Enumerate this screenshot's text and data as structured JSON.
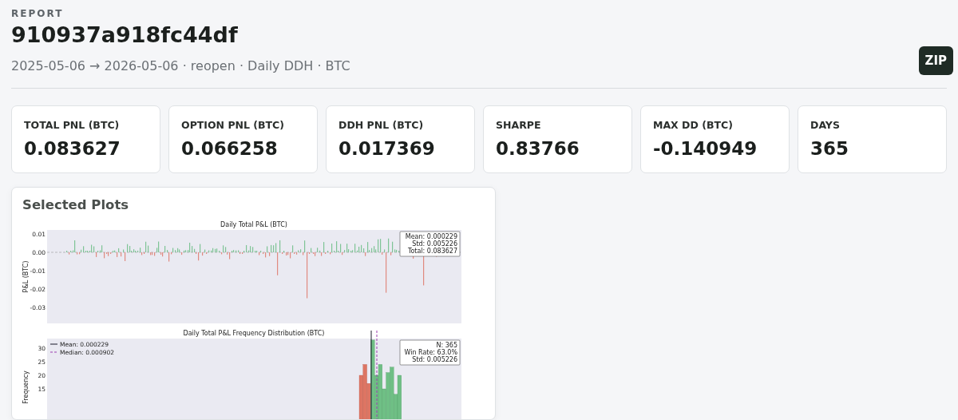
{
  "header": {
    "eyebrow": "REPORT",
    "title": "910937a918fc44df",
    "subtitle": "2025-05-06 → 2026-05-06 · reopen · Daily DDH · BTC",
    "download_button": "ZIP"
  },
  "stats": [
    {
      "label": "TOTAL PNL (BTC)",
      "value": "0.083627"
    },
    {
      "label": "OPTION PNL (BTC)",
      "value": "0.066258"
    },
    {
      "label": "DDH PNL (BTC)",
      "value": "0.017369"
    },
    {
      "label": "SHARPE",
      "value": "0.83766"
    },
    {
      "label": "MAX DD (BTC)",
      "value": "-0.140949"
    },
    {
      "label": "DAYS",
      "value": "365"
    }
  ],
  "plots_panel": {
    "title": "Selected Plots",
    "plots": [
      {
        "kind": "daily_bars",
        "title": "Daily Total P&L (BTC)",
        "ylabel": "P&L (BTC)",
        "yticks": [
          "0.01",
          "0.00",
          "-0.01",
          "-0.02",
          "-0.03"
        ],
        "stats": [
          "Mean: 0.000229",
          "Std: 0.005226",
          "Total: 0.083627"
        ]
      },
      {
        "kind": "histogram",
        "title": "Daily Total P&L Frequency Distribution (BTC)",
        "ylabel": "Frequency",
        "yticks": [
          "30",
          "25",
          "20",
          "15"
        ],
        "legend": [
          {
            "kind": "solid",
            "label": "Mean: 0.000229"
          },
          {
            "kind": "dashed",
            "label": "Median: 0.000902"
          }
        ],
        "stats": [
          "N: 365",
          "Win Rate: 63.0%",
          "Std: 0.005226"
        ]
      }
    ]
  }
}
